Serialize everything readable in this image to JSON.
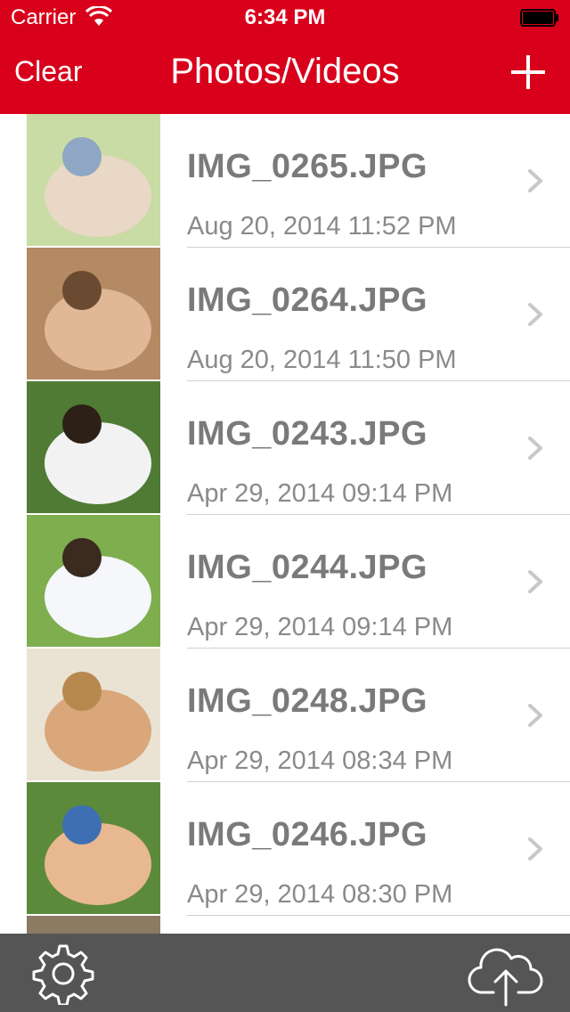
{
  "status_bar": {
    "carrier": "Carrier",
    "time": "6:34 PM"
  },
  "nav": {
    "left_button": "Clear",
    "title": "Photos/Videos",
    "right_icon": "plus-icon"
  },
  "items": [
    {
      "name": "IMG_0265.JPG",
      "date": "Aug 20, 2014 11:52 PM",
      "thumb_colors": [
        "#c9dca6",
        "#e9d8c6",
        "#8fa7c4"
      ]
    },
    {
      "name": "IMG_0264.JPG",
      "date": "Aug 20, 2014 11:50 PM",
      "thumb_colors": [
        "#b38a63",
        "#e0b896",
        "#6b4a32"
      ]
    },
    {
      "name": "IMG_0243.JPG",
      "date": "Apr 29, 2014 09:14 PM",
      "thumb_colors": [
        "#4f7b35",
        "#f2f2f2",
        "#2d2016"
      ]
    },
    {
      "name": "IMG_0244.JPG",
      "date": "Apr 29, 2014 09:14 PM",
      "thumb_colors": [
        "#7fae4f",
        "#f5f7fa",
        "#3a2a20"
      ]
    },
    {
      "name": "IMG_0248.JPG",
      "date": "Apr 29, 2014 08:34 PM",
      "thumb_colors": [
        "#eae3d4",
        "#d9a77a",
        "#b7894f"
      ]
    },
    {
      "name": "IMG_0246.JPG",
      "date": "Apr 29, 2014 08:30 PM",
      "thumb_colors": [
        "#5c8a3b",
        "#e8b890",
        "#3f6fb3"
      ]
    },
    {
      "name": "",
      "date": "",
      "thumb_colors": [
        "#8d7a62",
        "#b0a08a",
        "#6e5f4c"
      ]
    }
  ],
  "toolbar": {
    "left_icon": "gear-icon",
    "right_icon": "cloud-upload-icon"
  },
  "colors": {
    "accent": "#d8001a",
    "toolbar": "#555555",
    "text_primary": "#7a7a7a",
    "text_secondary": "#8a8a8a"
  }
}
